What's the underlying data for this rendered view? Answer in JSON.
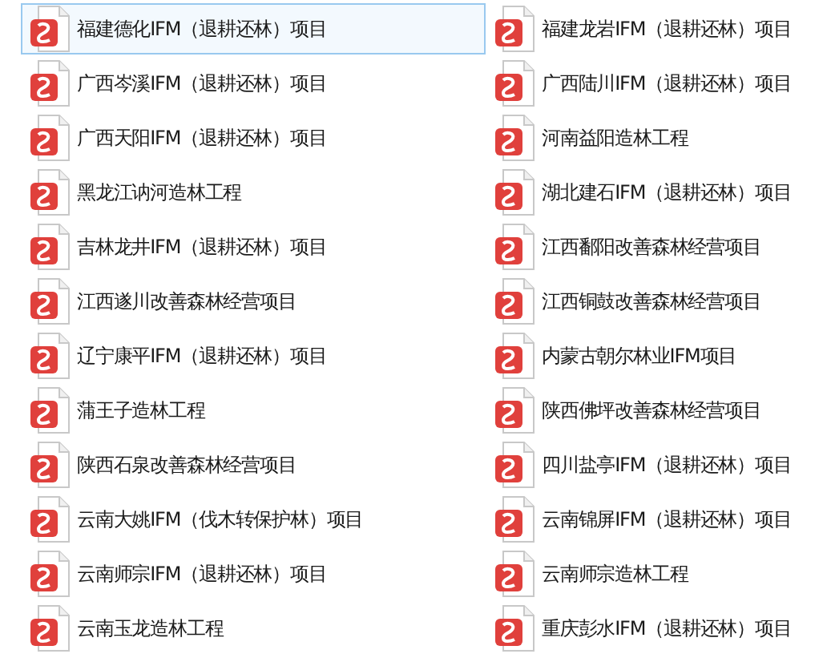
{
  "files": [
    {
      "name": "福建德化IFM（退耕还林）项目",
      "selected": true
    },
    {
      "name": "福建龙岩IFM（退耕还林）项目",
      "selected": false
    },
    {
      "name": "广西岑溪IFM（退耕还林）项目",
      "selected": false
    },
    {
      "name": "广西陆川IFM（退耕还林）项目",
      "selected": false
    },
    {
      "name": "广西天阳IFM（退耕还林）项目",
      "selected": false
    },
    {
      "name": "河南益阳造林工程",
      "selected": false
    },
    {
      "name": "黑龙江讷河造林工程",
      "selected": false
    },
    {
      "name": "湖北建石IFM（退耕还林）项目",
      "selected": false
    },
    {
      "name": "吉林龙井IFM（退耕还林）项目",
      "selected": false
    },
    {
      "name": "江西鄱阳改善森林经营项目",
      "selected": false
    },
    {
      "name": "江西遂川改善森林经营项目",
      "selected": false
    },
    {
      "name": "江西铜鼓改善森林经营项目",
      "selected": false
    },
    {
      "name": "辽宁康平IFM（退耕还林）项目",
      "selected": false
    },
    {
      "name": "内蒙古朝尔林业IFM项目",
      "selected": false
    },
    {
      "name": "蒲王子造林工程",
      "selected": false
    },
    {
      "name": "陕西佛坪改善森林经营项目",
      "selected": false
    },
    {
      "name": "陕西石泉改善森林经营项目",
      "selected": false
    },
    {
      "name": "四川盐亭IFM（退耕还林）项目",
      "selected": false
    },
    {
      "name": "云南大姚IFM（伐木转保护林）项目",
      "selected": false
    },
    {
      "name": "云南锦屏IFM（退耕还林）项目",
      "selected": false
    },
    {
      "name": "云南师宗IFM（退耕还林）项目",
      "selected": false
    },
    {
      "name": "云南师宗造林工程",
      "selected": false
    },
    {
      "name": "云南玉龙造林工程",
      "selected": false
    },
    {
      "name": "重庆彭水IFM（退耕还林）项目",
      "selected": false
    }
  ]
}
